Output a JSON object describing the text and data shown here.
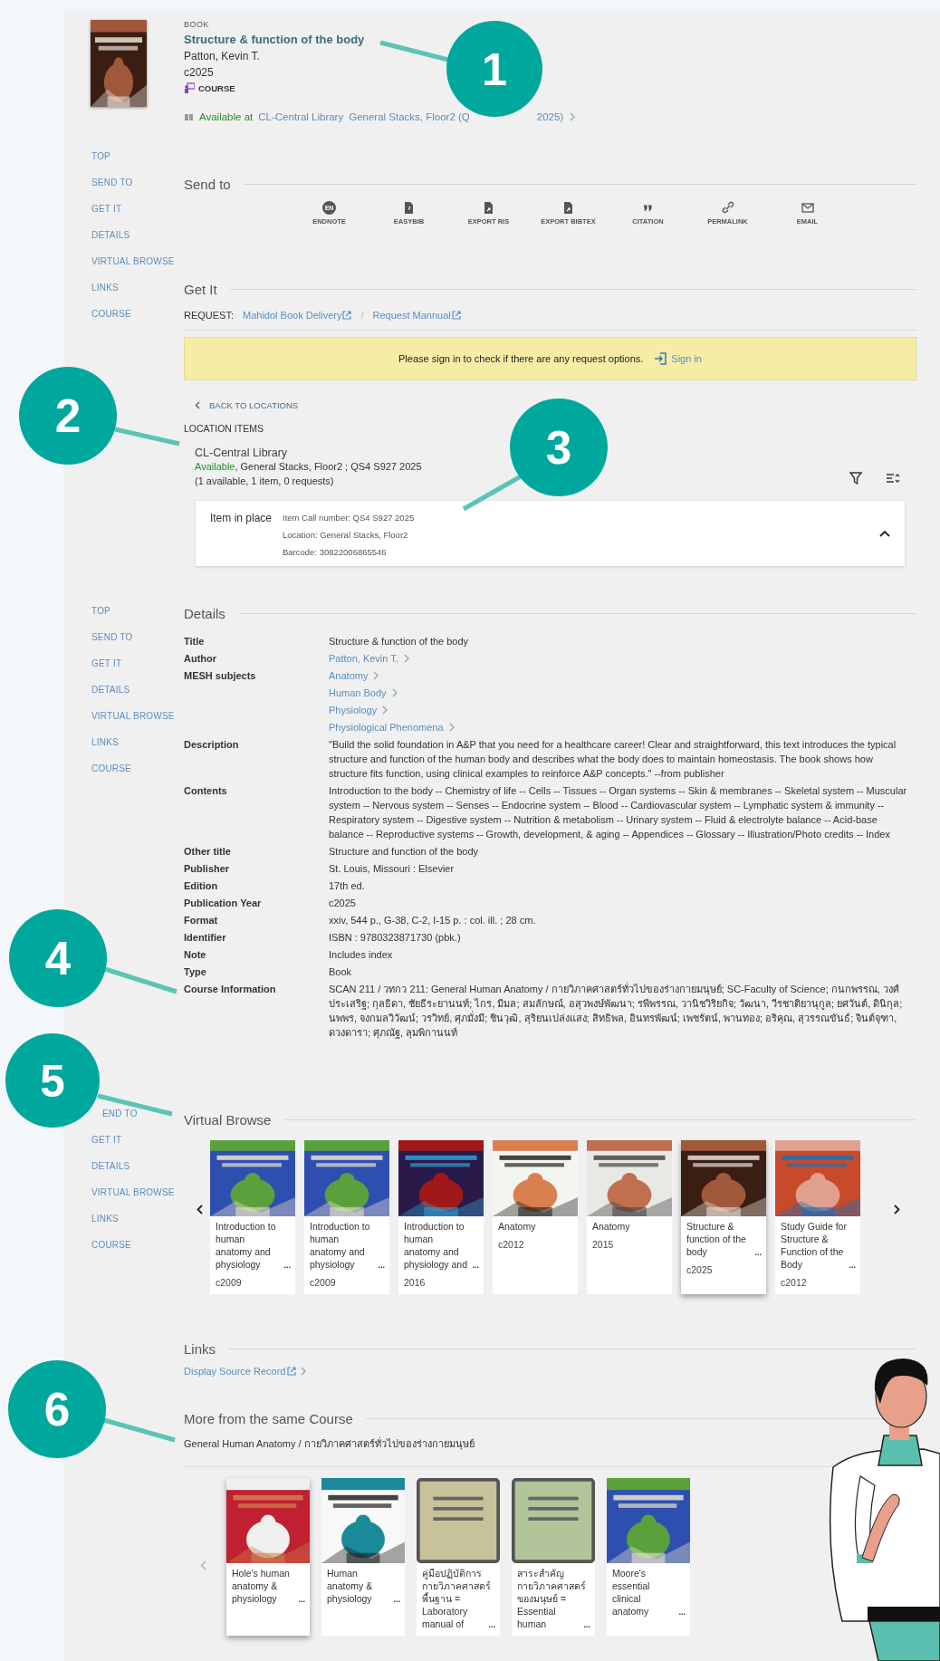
{
  "record": {
    "type": "BOOK",
    "title": "Structure & function of the body",
    "author": "Patton, Kevin T.",
    "date": "c2025",
    "badge": "COURSE",
    "availability": {
      "status": "Available at",
      "library": "CL-Central Library",
      "location": "General Stacks, Floor2 (Q",
      "location_end": "2025)"
    }
  },
  "navs": [
    {
      "items": [
        "TOP",
        "SEND TO",
        "GET IT",
        "DETAILS",
        "VIRTUAL BROWSE",
        "LINKS",
        "COURSE"
      ]
    },
    {
      "items": [
        "TOP",
        "SEND TO",
        "GET IT",
        "DETAILS",
        "VIRTUAL BROWSE",
        "LINKS",
        "COURSE"
      ]
    },
    {
      "items": [
        "END TO",
        "GET IT",
        "DETAILS",
        "VIRTUAL BROWSE",
        "LINKS",
        "COURSE"
      ]
    }
  ],
  "send_to": {
    "heading": "Send to",
    "actions": [
      {
        "kind": "endnote",
        "icon_text": "EN",
        "label": "ENDNOTE"
      },
      {
        "kind": "file",
        "label": "EASYBIB"
      },
      {
        "kind": "export",
        "label": "EXPORT RIS"
      },
      {
        "kind": "export",
        "label": "EXPORT BIBTEX"
      },
      {
        "kind": "quote",
        "label": "CITATION"
      },
      {
        "kind": "link",
        "label": "PERMALINK"
      },
      {
        "kind": "mail",
        "label": "EMAIL"
      }
    ]
  },
  "get_it": {
    "heading": "Get It",
    "request_label": "REQUEST:",
    "request_links": [
      "Mahidol Book Delivery",
      "Request Mannual"
    ],
    "separator": "/",
    "banner": {
      "message": "Please sign in to check if there are any request options.",
      "action": "Sign in"
    },
    "back": "BACK TO LOCATIONS",
    "location_heading": "LOCATION ITEMS",
    "location": {
      "name": "CL-Central Library",
      "status": "Available",
      "detail": ", General Stacks, Floor2 ; QS4 S927 2025",
      "counts": "(1 available, 1 item, 0 requests)"
    },
    "item": {
      "status": "Item in place",
      "lines": [
        "Item Call number: QS4 S927 2025",
        "Location: General Stacks, Floor2",
        "Barcode: 30822006865546"
      ],
      "expanded": true
    }
  },
  "details": {
    "heading": "Details",
    "rows": [
      {
        "label": "Title",
        "value": "Structure & function of the body"
      },
      {
        "label": "Author",
        "links": [
          "Patton, Kevin T."
        ]
      },
      {
        "label": "MESH subjects",
        "links": [
          "Anatomy",
          "Human Body",
          "Physiology",
          "Physiological Phenomena"
        ]
      },
      {
        "label": "Description",
        "value": "\"Build the solid foundation in A&P that you need for a healthcare career! Clear and straightforward, this text introduces the typical structure and function of the human body and describes what the body does to maintain homeostasis. The book shows how structure fits function, using clinical examples to reinforce A&P concepts.\" --from publisher"
      },
      {
        "label": "Contents",
        "value": "Introduction to the body -- Chemistry of life -- Cells -- Tissues -- Organ systems -- Skin & membranes -- Skeletal system -- Muscular system -- Nervous system -- Senses -- Endocrine system -- Blood -- Cardiovascular system -- Lymphatic system & immunity -- Respiratory system -- Digestive system -- Nutrition & metabolism -- Urinary system -- Fluid & electrolyte balance -- Acid-base balance -- Reproductive systems -- Growth, development, & aging -- Appendices -- Glossary -- Illustration/Photo credits -- Index"
      },
      {
        "label": "Other title",
        "value": "Structure and function of the body"
      },
      {
        "label": "Publisher",
        "value": "St. Louis, Missouri : Elsevier"
      },
      {
        "label": "Edition",
        "value": "17th ed."
      },
      {
        "label": "Publication Year",
        "value": "c2025"
      },
      {
        "label": "Format",
        "value": "xxiv, 544 p., G-38, C-2, I-15 p. : col. ill. ; 28 cm."
      },
      {
        "label": "Identifier",
        "value": "ISBN : 9780323871730 (pbk.)"
      },
      {
        "label": "Note",
        "value": "Includes index"
      },
      {
        "label": "Type",
        "value": "Book"
      },
      {
        "label": "Course Information",
        "value": "SCAN 211 / วทกว 211: General Human Anatomy / กายวิภาคศาสตร์ทั่วไปของร่างกายมนุษย์; SC-Faculty of Science; กนกพรรณ, วงศ์ประเสริฐ; กุลธิดา, ชัยธีระยานนท์; ไกร, มีมล; สมลักษณ์, อสุวพงษ์พัฒนา; รพีพรรณ, วานิชวิริยกิจ; วัฒนา, วีรชาติยานุกูล; ยศวันต์, ดินิกุล; นพพร, จงกมลวิวัฒน์; วรวิทย์, ศุภมั่งมี; ชินวุฒิ, สุริยนเปล่งแสง; สิทธิพล, อินทรพัฒน์; เพชรัตน์, พานทอง; อริคุณ, สุวรรณขันธ์; จินต์จุฑา, ดวงดารา; ศุภณัฐ, ลุมพิกานนท์"
      }
    ]
  },
  "virtual_browse": {
    "heading": "Virtual Browse",
    "cards": [
      {
        "title": "Introduction to human anatomy and physiology",
        "more": "...",
        "date": "c2009",
        "selected": false
      },
      {
        "title": "Introduction to human anatomy and physiology",
        "more": "...",
        "date": "c2009",
        "selected": false
      },
      {
        "title": "Introduction to human anatomy and physiology and",
        "more": "...",
        "date": "2016",
        "selected": false
      },
      {
        "title": "Anatomy",
        "date": "c2012",
        "selected": false
      },
      {
        "title": "Anatomy",
        "date": "2015",
        "selected": false
      },
      {
        "title": "Structure & function of the body",
        "more": "...",
        "date": "c2025",
        "selected": true
      },
      {
        "title": "Study Guide for Structure & Function of the Body",
        "more": "...",
        "date": "c2012",
        "selected": false
      }
    ]
  },
  "links": {
    "heading": "Links",
    "items": [
      "Display Source Record"
    ]
  },
  "course": {
    "heading": "More from the same Course",
    "name": "General Human Anatomy / กายวิภาคศาสตร์ทั่วไปของร่างกายมนุษย์",
    "cards": [
      {
        "kind": "picture",
        "title": "Hole's human anatomy & physiology",
        "more": "...",
        "selected": true
      },
      {
        "kind": "picture",
        "title": "Human anatomy & physiology",
        "more": "...",
        "selected": false
      },
      {
        "kind": "placeholder",
        "color": "#c8c29a",
        "title": "คู่มือปฏิบัติการกายวิภาคศาสตร์พื้นฐาน = Laboratory manual of",
        "more": "...",
        "selected": false
      },
      {
        "kind": "placeholder",
        "color": "#b2c49a",
        "title": "สาระสำคัญกายวิภาคศาสตร์ของมนุษย์ = Essential human",
        "more": "...",
        "selected": false
      },
      {
        "kind": "picture",
        "title": "Moore's essential clinical anatomy",
        "more": "...",
        "selected": false
      }
    ]
  },
  "callouts": [
    {
      "number": "1"
    },
    {
      "number": "2"
    },
    {
      "number": "3"
    },
    {
      "number": "4"
    },
    {
      "number": "5"
    },
    {
      "number": "6"
    }
  ]
}
